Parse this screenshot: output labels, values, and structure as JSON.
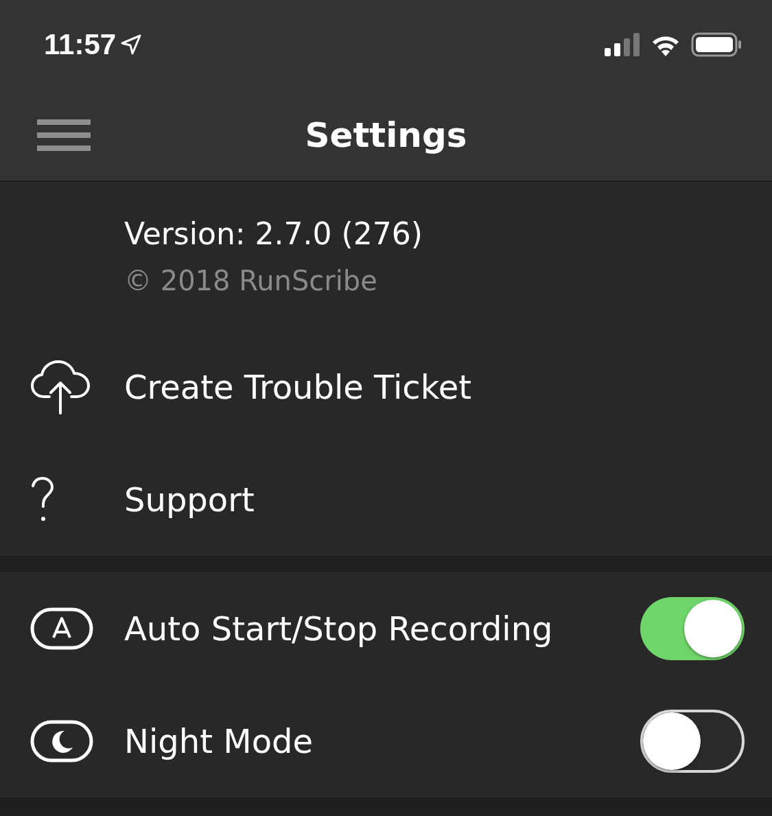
{
  "status_bar": {
    "time": "11:57"
  },
  "nav_bar": {
    "title": "Settings"
  },
  "about": {
    "version": "Version: 2.7.0 (276)",
    "copyright": "© 2018 RunScribe"
  },
  "links": [
    {
      "label": "Create Trouble Ticket"
    },
    {
      "label": "Support"
    }
  ],
  "toggles": [
    {
      "label": "Auto Start/Stop Recording",
      "on": true
    },
    {
      "label": "Night Mode",
      "on": false
    }
  ]
}
